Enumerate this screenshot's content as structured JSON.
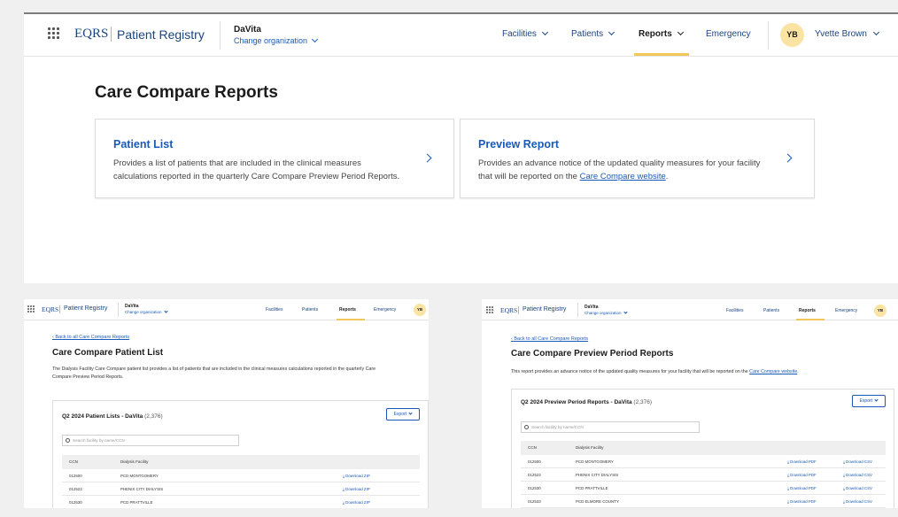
{
  "app": {
    "brand": "EQRS",
    "product": "Patient Registry",
    "org_name": "DaVita",
    "org_change": "Change organization",
    "nav": [
      "Facilities",
      "Patients",
      "Reports",
      "Emergency"
    ],
    "user_initials": "YB",
    "user_name": "Yvette Brown"
  },
  "main": {
    "title": "Care Compare Reports",
    "cards": [
      {
        "title": "Patient List",
        "desc_line1": "Provides a list of patients that are included in the clinical measures",
        "desc_line2": "calculations reported in the quarterly Care Compare Preview Period Reports."
      },
      {
        "title": "Preview Report",
        "desc_line1": "Provides an advance notice of the updated quality measures for your facility",
        "desc_line2_pre": "that will be reported on the ",
        "desc_link": "Care Compare website",
        "desc_line2_post": "."
      }
    ]
  },
  "patient_list_page": {
    "back": "Back to all Care Compare Reports",
    "title": "Care Compare Patient List",
    "desc_line1": "The Dialysis Facility Care Compare patient list provides a list of patients that are included in the clinical measures calculations reported in the quarterly Care",
    "desc_line2": "Compare Preview Period Reports.",
    "panel_title": "Q2 2024 Patient Lists - DaVita",
    "panel_count": "(2,376)",
    "export": "Export",
    "search_placeholder": "Search facility by name/CCN",
    "columns": [
      "CCN",
      "Dialysis Facility"
    ],
    "rows": [
      {
        "ccn": "012500",
        "facility": "PCD MONTGOMERY",
        "action": "Download ZIP"
      },
      {
        "ccn": "012523",
        "facility": "PHENIX CITY DIALYSIS",
        "action": "Download ZIP"
      },
      {
        "ccn": "012530",
        "facility": "PCD PRATTVILLE",
        "action": "Download ZIP"
      }
    ]
  },
  "preview_page": {
    "back": "Back to all Care Compare Reports",
    "title": "Care Compare Preview Period Reports",
    "desc_pre": "This report provides an advance notice of the updated quality measures for your facility that will be reported on the ",
    "desc_link": "Care Compare website",
    "desc_post": ".",
    "panel_title": "Q2 2024 Preview Period Reports - DaVita",
    "panel_count": "(2,376)",
    "export": "Export",
    "search_placeholder": "Search facility by name/CCN",
    "columns": [
      "CCN",
      "Dialysis Facility"
    ],
    "rows": [
      {
        "ccn": "012500",
        "facility": "PCD MONTGOMERY",
        "pdf": "Download PDF",
        "csv": "Download CSV"
      },
      {
        "ccn": "012523",
        "facility": "PHENIX CITY DIALYSIS",
        "pdf": "Download PDF",
        "csv": "Download CSV"
      },
      {
        "ccn": "012530",
        "facility": "PCD PRATTVILLE",
        "pdf": "Download PDF",
        "csv": "Download CSV"
      },
      {
        "ccn": "012533",
        "facility": "PCD ELMORE COUNTY",
        "pdf": "Download PDF",
        "csv": "Download CSV"
      }
    ]
  }
}
